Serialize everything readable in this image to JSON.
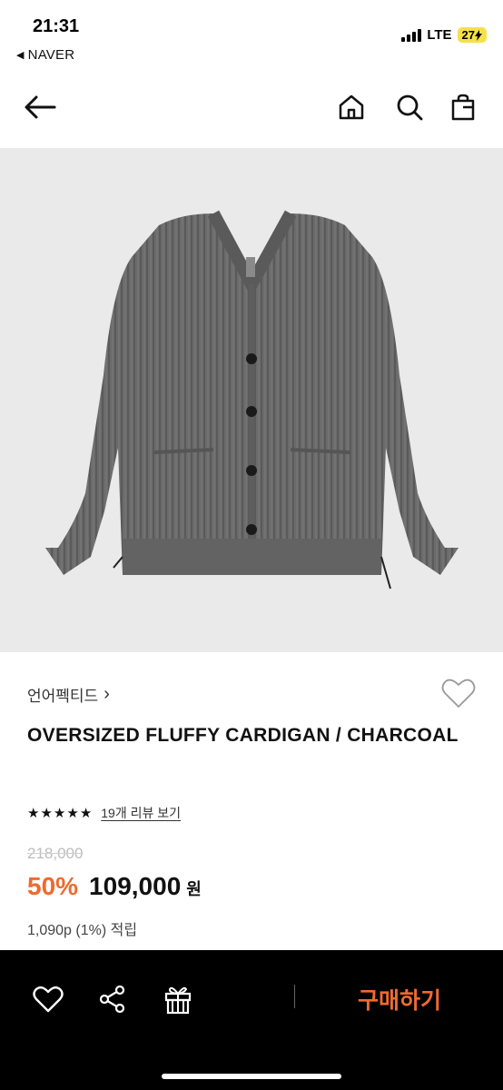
{
  "status_bar": {
    "time": "21:31",
    "back_app": "NAVER",
    "network": "LTE",
    "battery": "27"
  },
  "navbar": {
    "icons": [
      "back-arrow-icon",
      "home-icon",
      "search-icon",
      "shopping-bag-icon"
    ]
  },
  "product": {
    "brand": "언어펙티드",
    "brand_chevron": "›",
    "title": "OVERSIZED FLUFFY CARDIGAN / CHARCOAL",
    "rating_stars": 5,
    "review_link": "19개 리뷰 보기",
    "original_price": "218,000",
    "discount": "50%",
    "price": "109,000",
    "currency": "원",
    "points": "1,090p (1%) 적립"
  },
  "bottom_bar": {
    "buy_label": "구매하기",
    "icons": [
      "heart-icon",
      "share-icon",
      "gift-icon"
    ]
  },
  "colors": {
    "accent": "#ee6a2f",
    "bottom_bar_bg": "#000000",
    "image_bg": "#eaeaea",
    "battery_bg": "#f6e04a"
  }
}
